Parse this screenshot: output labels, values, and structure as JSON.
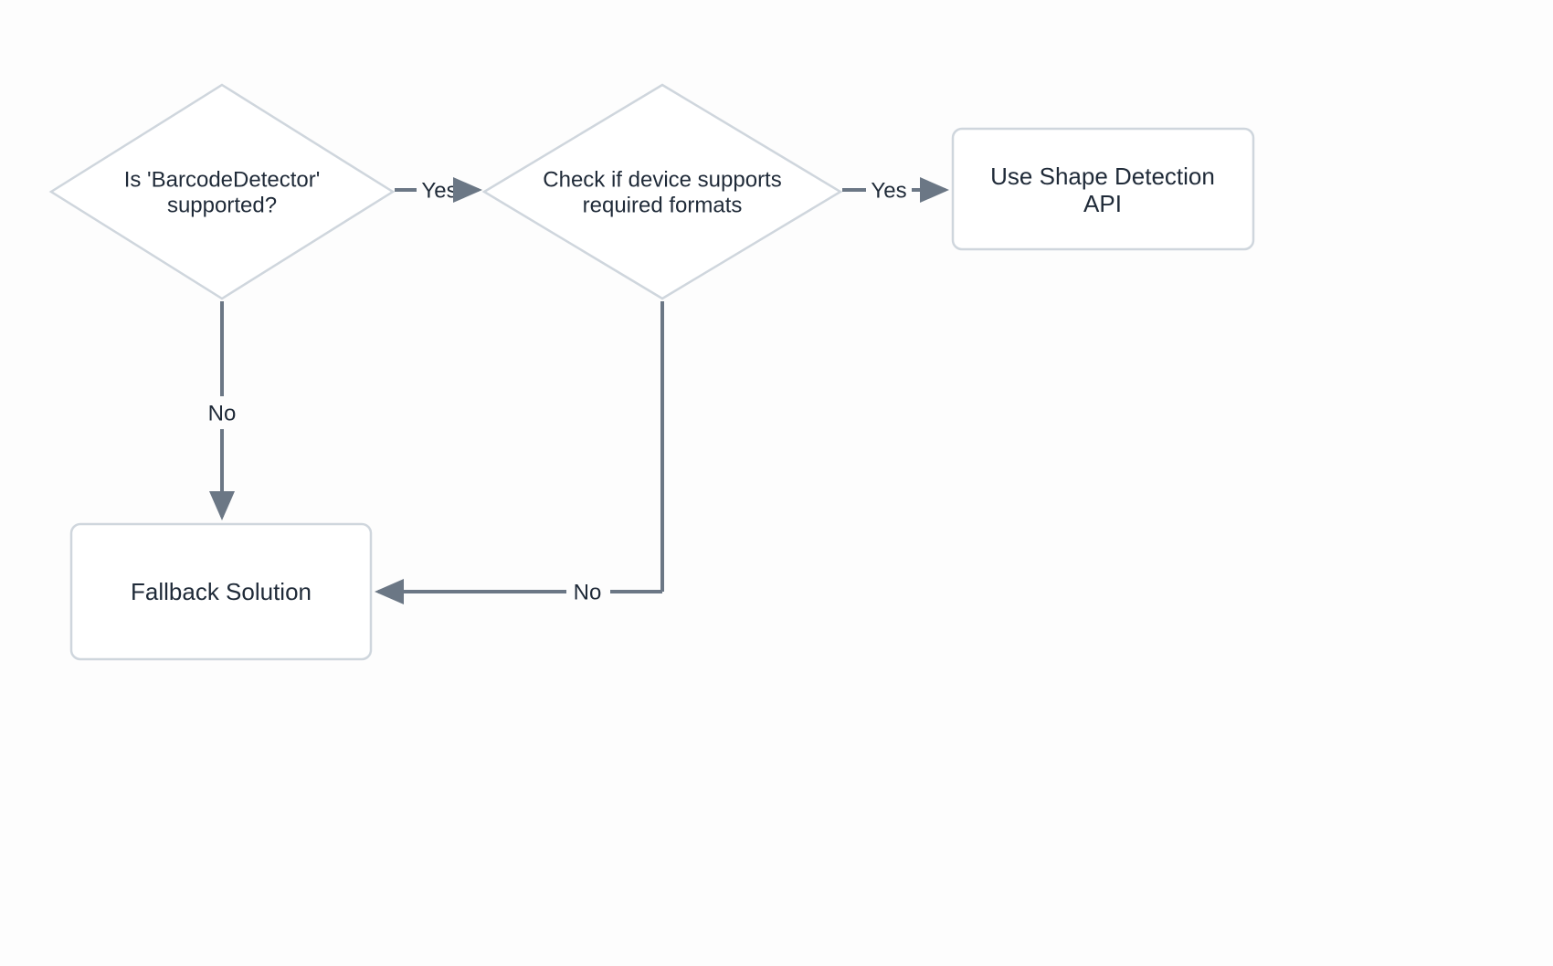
{
  "diagram": {
    "nodes": {
      "decision1": {
        "line1": "Is 'BarcodeDetector'",
        "line2": "supported?"
      },
      "decision2": {
        "line1": "Check if device supports",
        "line2": "required formats"
      },
      "action_use_api": {
        "line1": "Use Shape Detection",
        "line2": "API"
      },
      "action_fallback": {
        "line1": "Fallback Solution"
      }
    },
    "edges": {
      "d1_yes": "Yes",
      "d1_no": "No",
      "d2_yes": "Yes",
      "d2_no": "No"
    }
  }
}
